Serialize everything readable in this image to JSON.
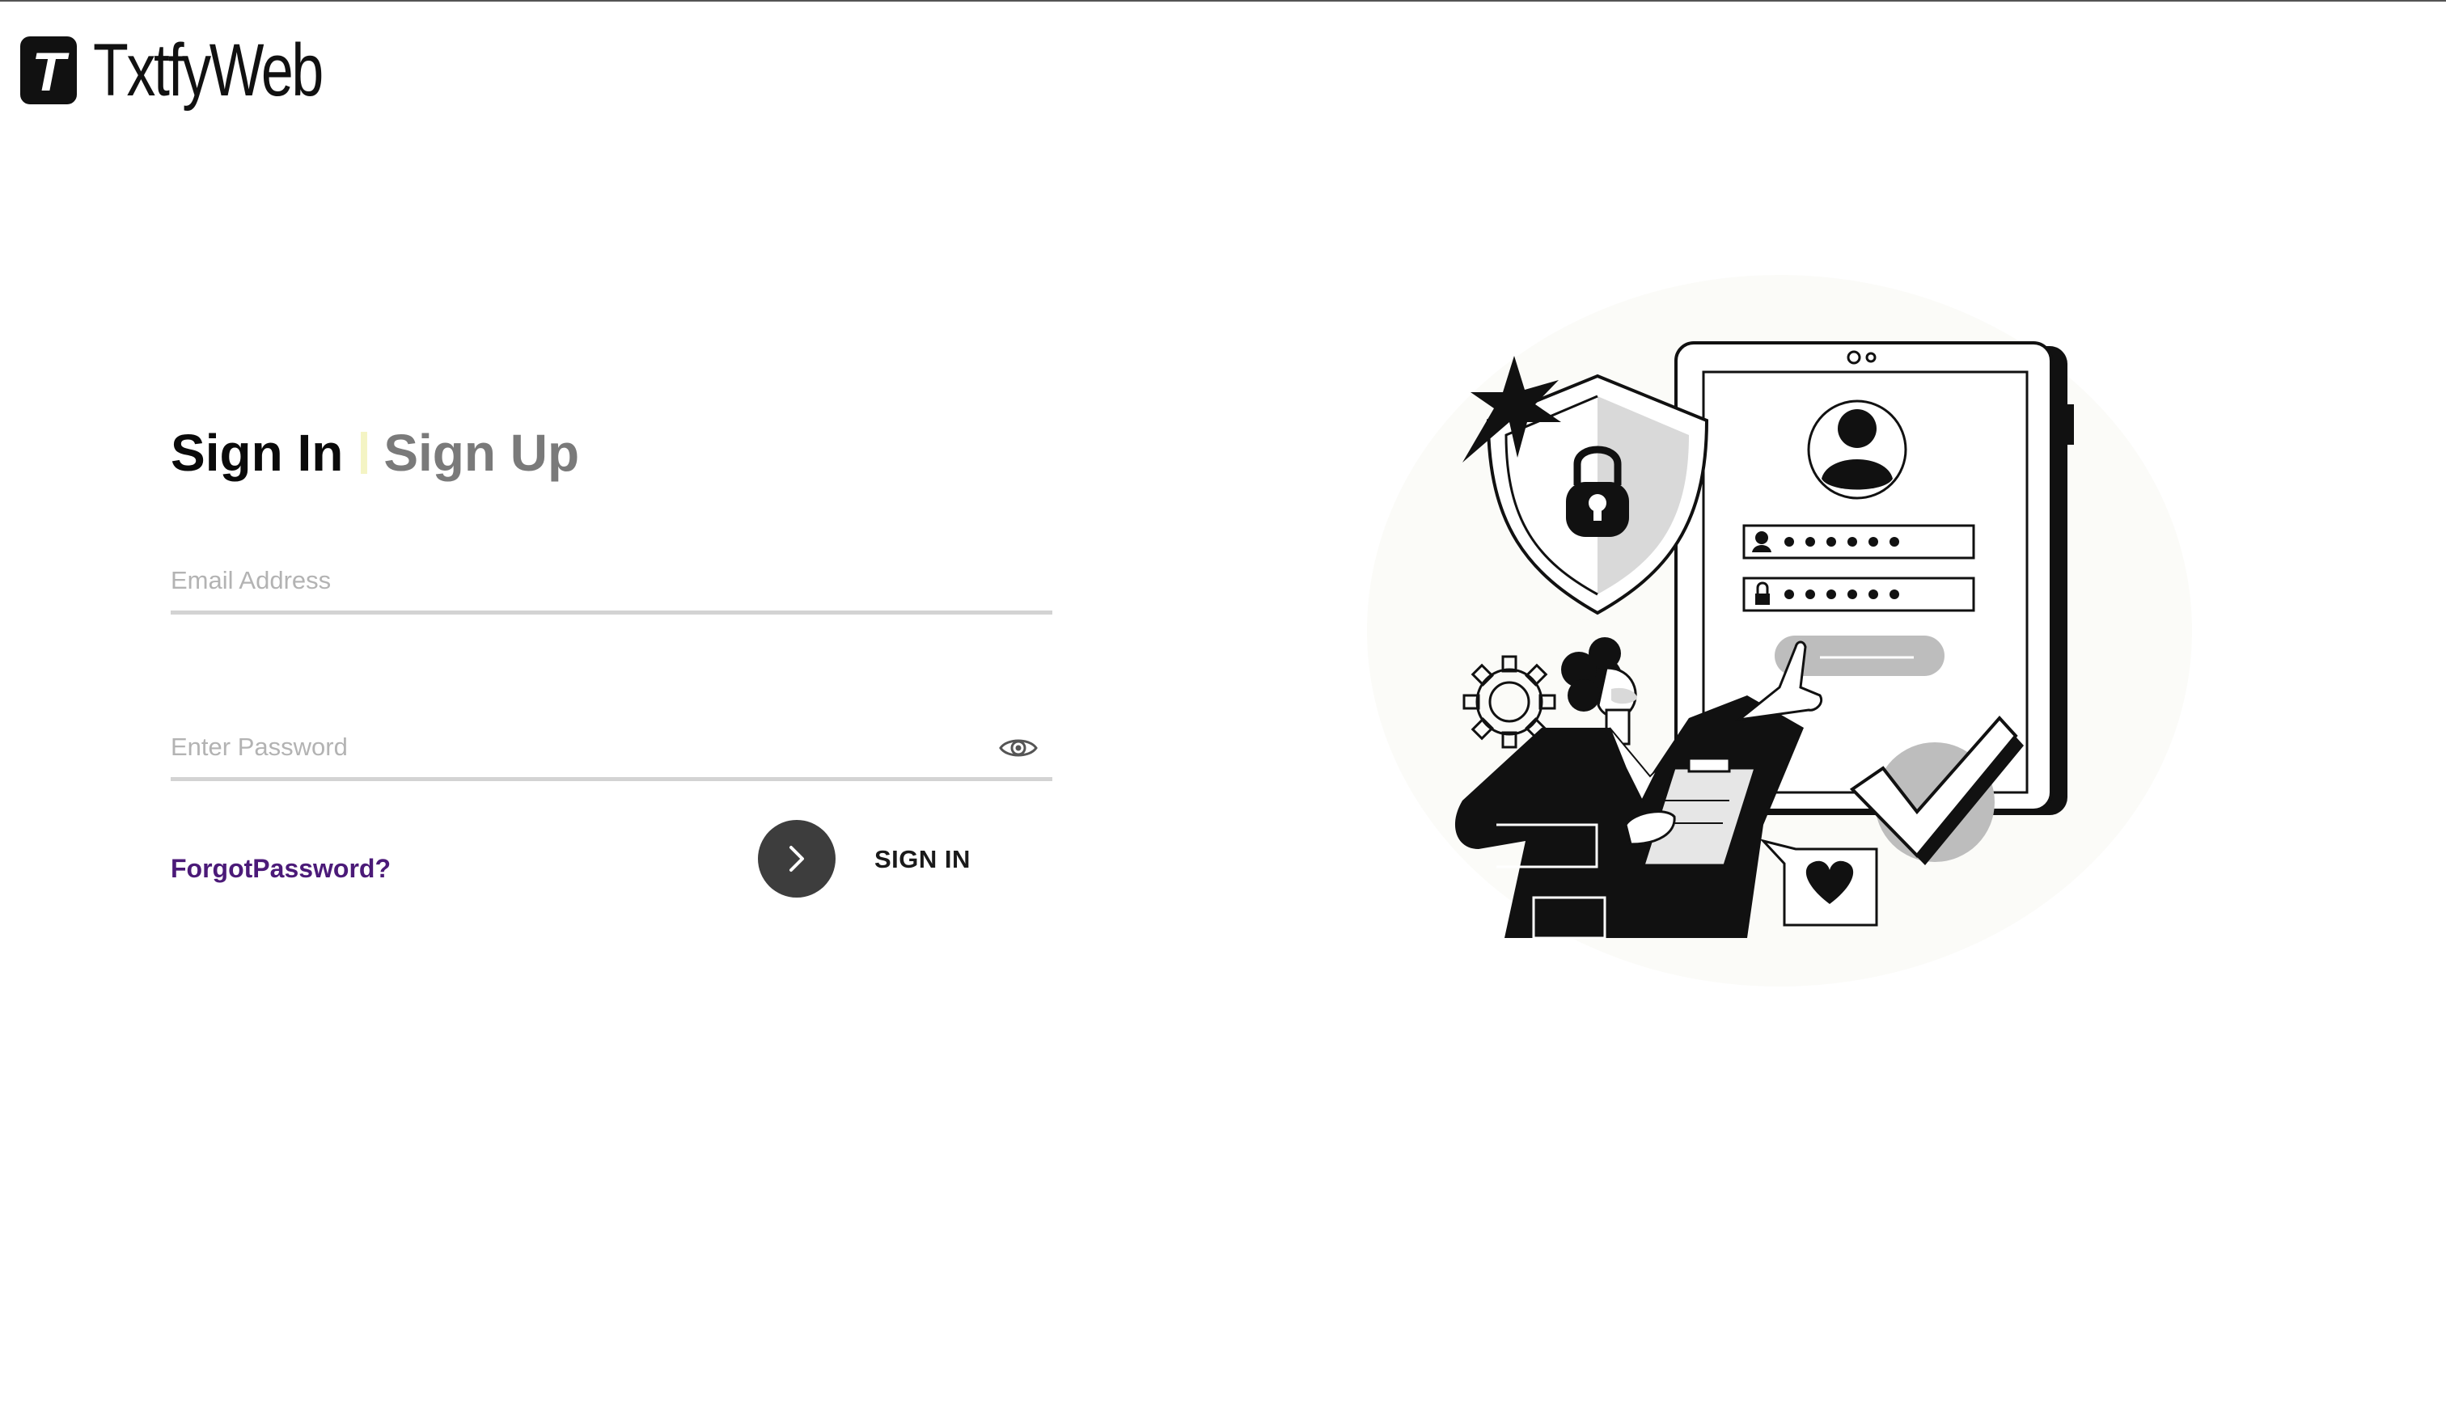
{
  "brand": {
    "logo_letter": "T",
    "name": "TxtfyWeb"
  },
  "auth_tabs": {
    "signin_label": "Sign In",
    "signup_label": "Sign Up"
  },
  "form": {
    "email": {
      "placeholder": "Email Address",
      "value": ""
    },
    "password": {
      "placeholder": "Enter Password",
      "value": ""
    },
    "forgot_label": "ForgotPassword?",
    "submit_label": "SIGN IN"
  },
  "icons": {
    "toggle_password": "eye-icon",
    "submit": "chevron-right-icon"
  },
  "colors": {
    "text_primary": "#0a0a0a",
    "tab_inactive": "#7a7a7a",
    "tab_separator": "#f4f4c4",
    "link": "#4b1a78",
    "button_bg": "#3d3d3d",
    "underline": "#d3d3d3"
  }
}
